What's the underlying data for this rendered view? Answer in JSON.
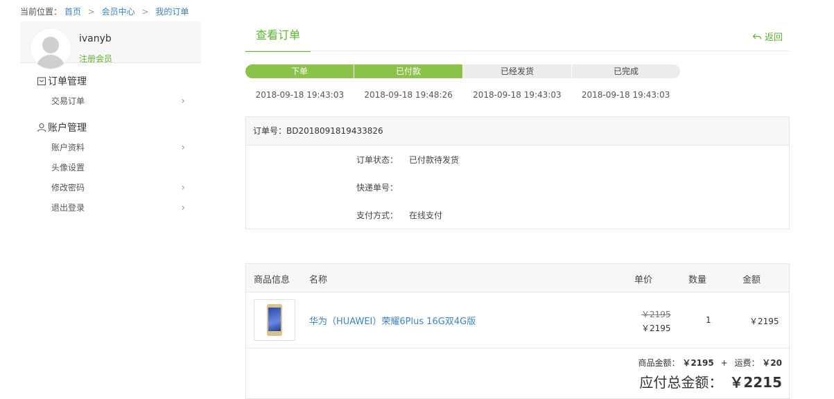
{
  "breadcrumb": {
    "prefix": "当前位置：",
    "items": [
      "首页",
      "会员中心",
      "我的订单"
    ],
    "separator": ">"
  },
  "user": {
    "name": "ivanyb",
    "level": "注册会员"
  },
  "sidebar": {
    "sections": [
      {
        "title": "订单管理",
        "icon": "order-icon",
        "items": [
          {
            "label": "交易订单",
            "chevron": true
          }
        ]
      },
      {
        "title": "账户管理",
        "icon": "user-icon",
        "items": [
          {
            "label": "账户资料",
            "chevron": true
          },
          {
            "label": "头像设置",
            "chevron": false
          },
          {
            "label": "修改密码",
            "chevron": true
          },
          {
            "label": "退出登录",
            "chevron": true
          }
        ]
      }
    ]
  },
  "main": {
    "tab": "查看订单",
    "back": "返回",
    "steps": [
      {
        "label": "下单",
        "done": true
      },
      {
        "label": "已付款",
        "done": true
      },
      {
        "label": "已经发货",
        "done": false
      },
      {
        "label": "已完成",
        "done": false
      }
    ],
    "times": [
      "2018-09-18 19:43:03",
      "2018-09-18 19:48:26",
      "2018-09-18 19:43:03",
      "2018-09-18 19:43:03"
    ],
    "order": {
      "number_label": "订单号：BD2018091819433826",
      "status_label": "订单状态：",
      "status_value": "已付款待发货",
      "tracking_label": "快递单号：",
      "tracking_value": "",
      "payment_label": "支付方式：",
      "payment_value": "在线支付"
    },
    "goods": {
      "headers": [
        "商品信息",
        "名称",
        "单价",
        "数量",
        "金额"
      ],
      "rows": [
        {
          "name": "华为（HUAWEI）荣耀6Plus 16G双4G版",
          "old_price": "￥2195",
          "price": "￥2195",
          "qty": "1",
          "amount": "￥2195"
        }
      ],
      "summary": {
        "goods_label": "商品金额：",
        "goods_amount": "￥2195",
        "plus": "+",
        "shipping_label": "运费：",
        "shipping_amount": "￥20",
        "total_label": "应付总金额：",
        "total_amount": "￥2215"
      }
    }
  },
  "colors": {
    "accent": "#5cb531",
    "step_done": "#8bc34a",
    "link": "#3b82c4"
  }
}
